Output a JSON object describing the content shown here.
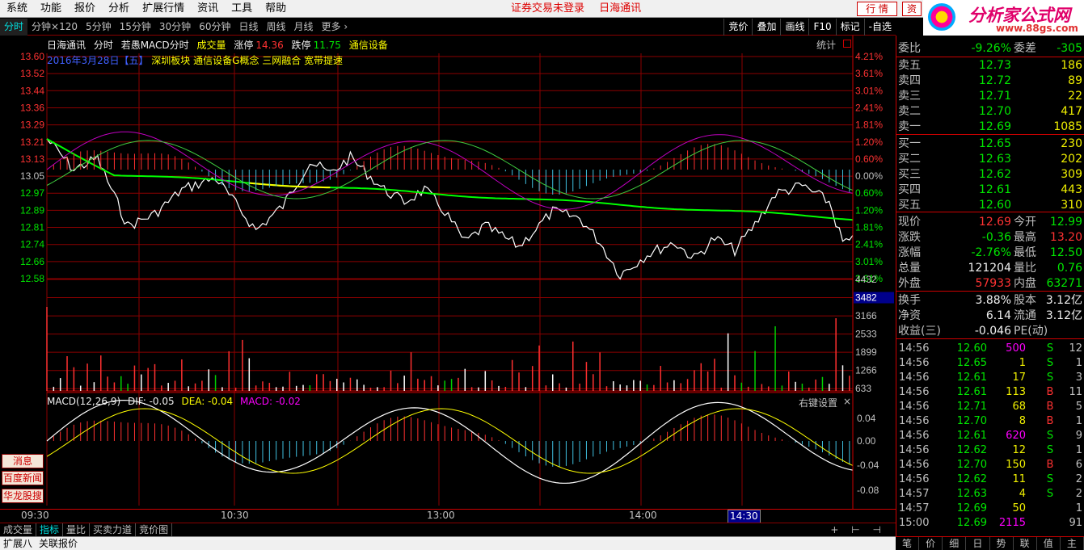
{
  "menu": {
    "items": [
      "系统",
      "功能",
      "报价",
      "分析",
      "扩展行情",
      "资讯",
      "工具",
      "帮助"
    ],
    "login_status": "证券交易未登录",
    "stock_name": "日海通讯",
    "hq_button": "行 情",
    "zi_button": "资"
  },
  "logo": {
    "brand": "分析家公式网",
    "url": "www.88gs.com"
  },
  "toolbar": {
    "tabs": [
      "分时",
      "分钟×120",
      "5分钟",
      "15分钟",
      "30分钟",
      "60分钟",
      "日线",
      "周线",
      "月线",
      "更多 ›"
    ],
    "active": "分时",
    "right_buttons": [
      "竞价",
      "叠加",
      "画线",
      "F10",
      "标记",
      "-自选"
    ]
  },
  "chart_header": {
    "stock": "日海通讯",
    "mode": "分时",
    "indicator": "若愚MACD分时",
    "vol_label": "成交量",
    "limit_up_label": "涨停",
    "limit_up": "14.36",
    "limit_down_label": "跌停",
    "limit_down": "11.75",
    "sector": "通信设备"
  },
  "chart_sub": {
    "date": "2016年3月28日【五】",
    "concepts": "深圳板块 通信设备G概念 三网融合 宽带提速"
  },
  "stat_label": "统计",
  "price_axis": {
    "left": [
      "13.60",
      "13.52",
      "13.44",
      "13.36",
      "13.29",
      "13.21",
      "13.13",
      "13.05",
      "12.97",
      "12.89",
      "12.81",
      "12.74",
      "12.66",
      "12.58"
    ],
    "right": [
      "4.21%",
      "3.61%",
      "3.01%",
      "2.41%",
      "1.81%",
      "1.20%",
      "0.60%",
      "0.00%",
      "0.60%",
      "1.20%",
      "1.81%",
      "2.41%",
      "3.01%",
      "3.61%"
    ]
  },
  "vol_axis": {
    "labels": [
      "4432",
      "3482",
      "3166",
      "2533",
      "1899",
      "1266",
      "633"
    ],
    "highlight": "3482"
  },
  "macd_header": {
    "name": "MACD(12,26,9)",
    "dif": "DIF: -0.05",
    "dea": "DEA: -0.04",
    "macd": "MACD: -0.02",
    "rclick": "右键设置",
    "close": "×"
  },
  "macd_axis": [
    "0.04",
    "0.00",
    "-0.04",
    "-0.08"
  ],
  "left_buttons": [
    "消息",
    "百度新闻",
    "华龙股搜"
  ],
  "time_axis": [
    "09:30",
    "10:30",
    "13:00",
    "14:00",
    "14:30"
  ],
  "time_highlight": "14:30",
  "bottom_tabs": [
    "成交量",
    "指标",
    "量比",
    "买卖力道",
    "竞价图"
  ],
  "bottom_nav": "+ ⊢ ⊣",
  "status_bar": [
    "扩展八",
    "关联报价"
  ],
  "quote": {
    "weibi": {
      "label": "委比",
      "value": "-9.26%",
      "label2": "委差",
      "value2": "-305"
    },
    "asks": [
      {
        "label": "卖五",
        "price": "12.73",
        "vol": "186"
      },
      {
        "label": "卖四",
        "price": "12.72",
        "vol": "89"
      },
      {
        "label": "卖三",
        "price": "12.71",
        "vol": "22"
      },
      {
        "label": "卖二",
        "price": "12.70",
        "vol": "417"
      },
      {
        "label": "卖一",
        "price": "12.69",
        "vol": "1085"
      }
    ],
    "bids": [
      {
        "label": "买一",
        "price": "12.65",
        "vol": "230"
      },
      {
        "label": "买二",
        "price": "12.63",
        "vol": "202"
      },
      {
        "label": "买三",
        "price": "12.62",
        "vol": "309"
      },
      {
        "label": "买四",
        "price": "12.61",
        "vol": "443"
      },
      {
        "label": "买五",
        "price": "12.60",
        "vol": "310"
      }
    ],
    "stats": [
      {
        "l1": "现价",
        "v1": "12.69",
        "c1": "up",
        "l2": "今开",
        "v2": "12.99",
        "c2": "dn"
      },
      {
        "l1": "涨跌",
        "v1": "-0.36",
        "c1": "dn",
        "l2": "最高",
        "v2": "13.20",
        "c2": "up"
      },
      {
        "l1": "涨幅",
        "v1": "-2.76%",
        "c1": "dn",
        "l2": "最低",
        "v2": "12.50",
        "c2": "dn"
      },
      {
        "l1": "总量",
        "v1": "121204",
        "c1": "wh",
        "l2": "量比",
        "v2": "0.76",
        "c2": "dn"
      },
      {
        "l1": "外盘",
        "v1": "57933",
        "c1": "up",
        "l2": "内盘",
        "v2": "63271",
        "c2": "dn"
      }
    ],
    "fund": [
      {
        "l1": "换手",
        "v1": "3.88%",
        "l2": "股本",
        "v2": "3.12亿"
      },
      {
        "l1": "净资",
        "v1": "6.14",
        "l2": "流通",
        "v2": "3.12亿"
      },
      {
        "l1": "收益(三)",
        "v1": "-0.046",
        "l2": "PE(动)",
        "v2": ""
      }
    ]
  },
  "ticks": [
    {
      "t": "14:56",
      "p": "12.60",
      "pc": "dn",
      "q": "500",
      "qc": "mg",
      "d": "S",
      "dc": "dn",
      "n": "12"
    },
    {
      "t": "14:56",
      "p": "12.65",
      "pc": "dn",
      "q": "1",
      "qc": "or",
      "d": "S",
      "dc": "dn",
      "n": "1"
    },
    {
      "t": "14:56",
      "p": "12.61",
      "pc": "dn",
      "q": "17",
      "qc": "or",
      "d": "S",
      "dc": "dn",
      "n": "3"
    },
    {
      "t": "14:56",
      "p": "12.61",
      "pc": "dn",
      "q": "113",
      "qc": "or",
      "d": "B",
      "dc": "up",
      "n": "11"
    },
    {
      "t": "14:56",
      "p": "12.71",
      "pc": "dn",
      "q": "68",
      "qc": "or",
      "d": "B",
      "dc": "up",
      "n": "5"
    },
    {
      "t": "14:56",
      "p": "12.70",
      "pc": "dn",
      "q": "8",
      "qc": "or",
      "d": "B",
      "dc": "up",
      "n": "1"
    },
    {
      "t": "14:56",
      "p": "12.61",
      "pc": "dn",
      "q": "620",
      "qc": "mg",
      "d": "S",
      "dc": "dn",
      "n": "9"
    },
    {
      "t": "14:56",
      "p": "12.62",
      "pc": "dn",
      "q": "12",
      "qc": "or",
      "d": "S",
      "dc": "dn",
      "n": "1"
    },
    {
      "t": "14:56",
      "p": "12.70",
      "pc": "dn",
      "q": "150",
      "qc": "or",
      "d": "B",
      "dc": "up",
      "n": "6"
    },
    {
      "t": "14:56",
      "p": "12.62",
      "pc": "dn",
      "q": "11",
      "qc": "or",
      "d": "S",
      "dc": "dn",
      "n": "2"
    },
    {
      "t": "14:57",
      "p": "12.63",
      "pc": "dn",
      "q": "4",
      "qc": "or",
      "d": "S",
      "dc": "dn",
      "n": "2"
    },
    {
      "t": "14:57",
      "p": "12.69",
      "pc": "dn",
      "q": "50",
      "qc": "or",
      "d": "",
      "dc": "wh",
      "n": "1"
    },
    {
      "t": "15:00",
      "p": "12.69",
      "pc": "dn",
      "q": "2115",
      "qc": "mg",
      "d": "",
      "dc": "wh",
      "n": "91"
    }
  ],
  "right_tabs": [
    "笔",
    "价",
    "细",
    "日",
    "势",
    "联",
    "值",
    "主"
  ],
  "colors": {
    "up": "#ff3232",
    "down": "#00e600",
    "grid": "#8b0000",
    "price_line": "#ffffff",
    "avg_line": "#00ff00",
    "avg_line_late": "#ffff00",
    "dif_line": "#ffffff",
    "dea_line": "#ffff00"
  }
}
